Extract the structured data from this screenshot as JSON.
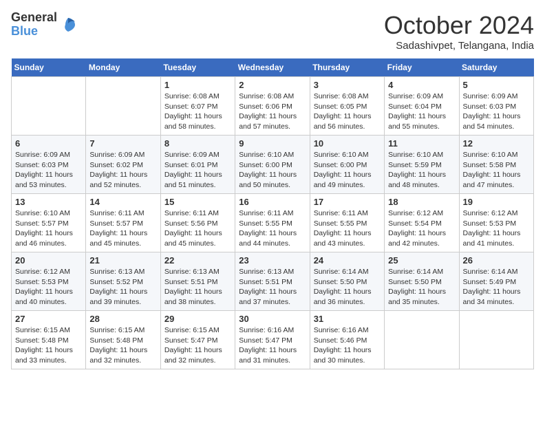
{
  "logo": {
    "line1": "General",
    "line2": "Blue"
  },
  "title": "October 2024",
  "location": "Sadashivpet, Telangana, India",
  "days_of_week": [
    "Sunday",
    "Monday",
    "Tuesday",
    "Wednesday",
    "Thursday",
    "Friday",
    "Saturday"
  ],
  "weeks": [
    [
      {
        "day": null
      },
      {
        "day": null
      },
      {
        "day": "1",
        "sunrise": "Sunrise: 6:08 AM",
        "sunset": "Sunset: 6:07 PM",
        "daylight": "Daylight: 11 hours and 58 minutes."
      },
      {
        "day": "2",
        "sunrise": "Sunrise: 6:08 AM",
        "sunset": "Sunset: 6:06 PM",
        "daylight": "Daylight: 11 hours and 57 minutes."
      },
      {
        "day": "3",
        "sunrise": "Sunrise: 6:08 AM",
        "sunset": "Sunset: 6:05 PM",
        "daylight": "Daylight: 11 hours and 56 minutes."
      },
      {
        "day": "4",
        "sunrise": "Sunrise: 6:09 AM",
        "sunset": "Sunset: 6:04 PM",
        "daylight": "Daylight: 11 hours and 55 minutes."
      },
      {
        "day": "5",
        "sunrise": "Sunrise: 6:09 AM",
        "sunset": "Sunset: 6:03 PM",
        "daylight": "Daylight: 11 hours and 54 minutes."
      }
    ],
    [
      {
        "day": "6",
        "sunrise": "Sunrise: 6:09 AM",
        "sunset": "Sunset: 6:03 PM",
        "daylight": "Daylight: 11 hours and 53 minutes."
      },
      {
        "day": "7",
        "sunrise": "Sunrise: 6:09 AM",
        "sunset": "Sunset: 6:02 PM",
        "daylight": "Daylight: 11 hours and 52 minutes."
      },
      {
        "day": "8",
        "sunrise": "Sunrise: 6:09 AM",
        "sunset": "Sunset: 6:01 PM",
        "daylight": "Daylight: 11 hours and 51 minutes."
      },
      {
        "day": "9",
        "sunrise": "Sunrise: 6:10 AM",
        "sunset": "Sunset: 6:00 PM",
        "daylight": "Daylight: 11 hours and 50 minutes."
      },
      {
        "day": "10",
        "sunrise": "Sunrise: 6:10 AM",
        "sunset": "Sunset: 6:00 PM",
        "daylight": "Daylight: 11 hours and 49 minutes."
      },
      {
        "day": "11",
        "sunrise": "Sunrise: 6:10 AM",
        "sunset": "Sunset: 5:59 PM",
        "daylight": "Daylight: 11 hours and 48 minutes."
      },
      {
        "day": "12",
        "sunrise": "Sunrise: 6:10 AM",
        "sunset": "Sunset: 5:58 PM",
        "daylight": "Daylight: 11 hours and 47 minutes."
      }
    ],
    [
      {
        "day": "13",
        "sunrise": "Sunrise: 6:10 AM",
        "sunset": "Sunset: 5:57 PM",
        "daylight": "Daylight: 11 hours and 46 minutes."
      },
      {
        "day": "14",
        "sunrise": "Sunrise: 6:11 AM",
        "sunset": "Sunset: 5:57 PM",
        "daylight": "Daylight: 11 hours and 45 minutes."
      },
      {
        "day": "15",
        "sunrise": "Sunrise: 6:11 AM",
        "sunset": "Sunset: 5:56 PM",
        "daylight": "Daylight: 11 hours and 45 minutes."
      },
      {
        "day": "16",
        "sunrise": "Sunrise: 6:11 AM",
        "sunset": "Sunset: 5:55 PM",
        "daylight": "Daylight: 11 hours and 44 minutes."
      },
      {
        "day": "17",
        "sunrise": "Sunrise: 6:11 AM",
        "sunset": "Sunset: 5:55 PM",
        "daylight": "Daylight: 11 hours and 43 minutes."
      },
      {
        "day": "18",
        "sunrise": "Sunrise: 6:12 AM",
        "sunset": "Sunset: 5:54 PM",
        "daylight": "Daylight: 11 hours and 42 minutes."
      },
      {
        "day": "19",
        "sunrise": "Sunrise: 6:12 AM",
        "sunset": "Sunset: 5:53 PM",
        "daylight": "Daylight: 11 hours and 41 minutes."
      }
    ],
    [
      {
        "day": "20",
        "sunrise": "Sunrise: 6:12 AM",
        "sunset": "Sunset: 5:53 PM",
        "daylight": "Daylight: 11 hours and 40 minutes."
      },
      {
        "day": "21",
        "sunrise": "Sunrise: 6:13 AM",
        "sunset": "Sunset: 5:52 PM",
        "daylight": "Daylight: 11 hours and 39 minutes."
      },
      {
        "day": "22",
        "sunrise": "Sunrise: 6:13 AM",
        "sunset": "Sunset: 5:51 PM",
        "daylight": "Daylight: 11 hours and 38 minutes."
      },
      {
        "day": "23",
        "sunrise": "Sunrise: 6:13 AM",
        "sunset": "Sunset: 5:51 PM",
        "daylight": "Daylight: 11 hours and 37 minutes."
      },
      {
        "day": "24",
        "sunrise": "Sunrise: 6:14 AM",
        "sunset": "Sunset: 5:50 PM",
        "daylight": "Daylight: 11 hours and 36 minutes."
      },
      {
        "day": "25",
        "sunrise": "Sunrise: 6:14 AM",
        "sunset": "Sunset: 5:50 PM",
        "daylight": "Daylight: 11 hours and 35 minutes."
      },
      {
        "day": "26",
        "sunrise": "Sunrise: 6:14 AM",
        "sunset": "Sunset: 5:49 PM",
        "daylight": "Daylight: 11 hours and 34 minutes."
      }
    ],
    [
      {
        "day": "27",
        "sunrise": "Sunrise: 6:15 AM",
        "sunset": "Sunset: 5:48 PM",
        "daylight": "Daylight: 11 hours and 33 minutes."
      },
      {
        "day": "28",
        "sunrise": "Sunrise: 6:15 AM",
        "sunset": "Sunset: 5:48 PM",
        "daylight": "Daylight: 11 hours and 32 minutes."
      },
      {
        "day": "29",
        "sunrise": "Sunrise: 6:15 AM",
        "sunset": "Sunset: 5:47 PM",
        "daylight": "Daylight: 11 hours and 32 minutes."
      },
      {
        "day": "30",
        "sunrise": "Sunrise: 6:16 AM",
        "sunset": "Sunset: 5:47 PM",
        "daylight": "Daylight: 11 hours and 31 minutes."
      },
      {
        "day": "31",
        "sunrise": "Sunrise: 6:16 AM",
        "sunset": "Sunset: 5:46 PM",
        "daylight": "Daylight: 11 hours and 30 minutes."
      },
      {
        "day": null
      },
      {
        "day": null
      }
    ]
  ]
}
